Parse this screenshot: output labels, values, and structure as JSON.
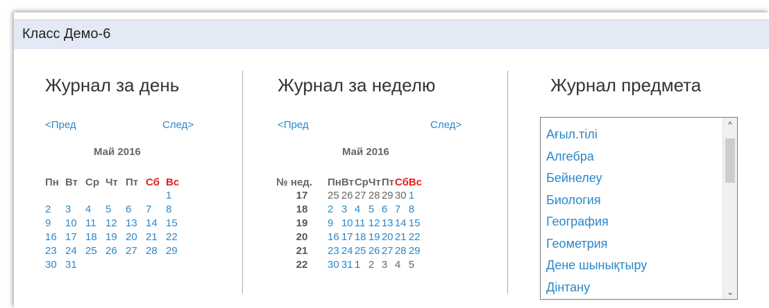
{
  "window": {
    "title": "Класс Демо-6"
  },
  "day_journal": {
    "title": "Журнал за день",
    "prev": "<Пред",
    "next": "След>",
    "month": "Май 2016",
    "weekdays": [
      "Пн",
      "Вт",
      "Ср",
      "Чт",
      "Пт",
      "Сб",
      "Вс"
    ],
    "weeks": [
      [
        "",
        "",
        "",
        "",
        "",
        "",
        "1"
      ],
      [
        "2",
        "3",
        "4",
        "5",
        "6",
        "7",
        "8"
      ],
      [
        "9",
        "10",
        "11",
        "12",
        "13",
        "14",
        "15"
      ],
      [
        "16",
        "17",
        "18",
        "19",
        "20",
        "21",
        "22"
      ],
      [
        "23",
        "24",
        "25",
        "26",
        "27",
        "28",
        "29"
      ],
      [
        "30",
        "31",
        "",
        "",
        "",
        "",
        ""
      ]
    ]
  },
  "week_journal": {
    "title": "Журнал за неделю",
    "prev": "<Пред",
    "next": "След>",
    "month": "Май 2016",
    "weeknum_header": "№ нед.",
    "weekdays": [
      "Пн",
      "Вт",
      "Ср",
      "Чт",
      "Пт",
      "Сб",
      "Вс"
    ],
    "weeks": [
      {
        "num": "17",
        "days": [
          "25",
          "26",
          "27",
          "28",
          "29",
          "30",
          "1"
        ]
      },
      {
        "num": "18",
        "days": [
          "2",
          "3",
          "4",
          "5",
          "6",
          "7",
          "8"
        ]
      },
      {
        "num": "19",
        "days": [
          "9",
          "10",
          "11",
          "12",
          "13",
          "14",
          "15"
        ]
      },
      {
        "num": "20",
        "days": [
          "16",
          "17",
          "18",
          "19",
          "20",
          "21",
          "22"
        ]
      },
      {
        "num": "21",
        "days": [
          "23",
          "24",
          "25",
          "26",
          "27",
          "28",
          "29"
        ]
      },
      {
        "num": "22",
        "days": [
          "30",
          "31",
          "1",
          "2",
          "3",
          "4",
          "5"
        ]
      }
    ]
  },
  "subject_journal": {
    "title": "Журнал предмета",
    "subjects": [
      "Ағыл.тілі",
      "Алгебра",
      "Бейнелеу",
      "Биология",
      "География",
      "Геометрия",
      "Дене шынықтыру",
      "Дінтану"
    ]
  },
  "colors": {
    "link": "#2a88c8",
    "weekend": "#e02020",
    "titlebar": "#e4eaf5"
  },
  "icons": {
    "scroll_up": "chevron-up-icon",
    "scroll_down": "chevron-down-icon"
  }
}
